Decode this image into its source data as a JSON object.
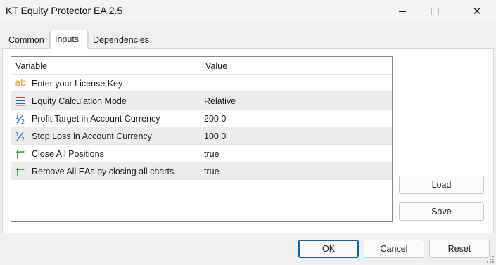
{
  "window": {
    "title": "KT Equity Protector EA 2.5"
  },
  "tabs": [
    {
      "label": "Common"
    },
    {
      "label": "Inputs"
    },
    {
      "label": "Dependencies"
    }
  ],
  "grid": {
    "header_variable": "Variable",
    "header_value": "Value",
    "rows": [
      {
        "icon": "ab-text-icon",
        "icon_text": "ab",
        "variable": "Enter your License Key",
        "value": ""
      },
      {
        "icon": "enum-list-icon",
        "variable": "Equity Calculation Mode",
        "value": "Relative"
      },
      {
        "icon": "fraction-icon",
        "variable": "Profit Target in Account Currency",
        "value": "200.0"
      },
      {
        "icon": "fraction-icon",
        "variable": "Stop Loss in Account Currency",
        "value": "100.0"
      },
      {
        "icon": "branch-arrow-icon",
        "variable": "Close All Positions",
        "value": "true"
      },
      {
        "icon": "branch-arrow-icon",
        "variable": "Remove All EAs by closing all charts.",
        "value": "true"
      }
    ]
  },
  "buttons": {
    "load": "Load",
    "save": "Save",
    "ok": "OK",
    "cancel": "Cancel",
    "reset": "Reset"
  },
  "colors": {
    "accent": "#0067c0",
    "alt_row": "#ececec",
    "icon_orange": "#e0a020",
    "icon_blue": "#2b6cb0",
    "icon_green": "#2e9e3a",
    "icon_red": "#d9453b"
  }
}
